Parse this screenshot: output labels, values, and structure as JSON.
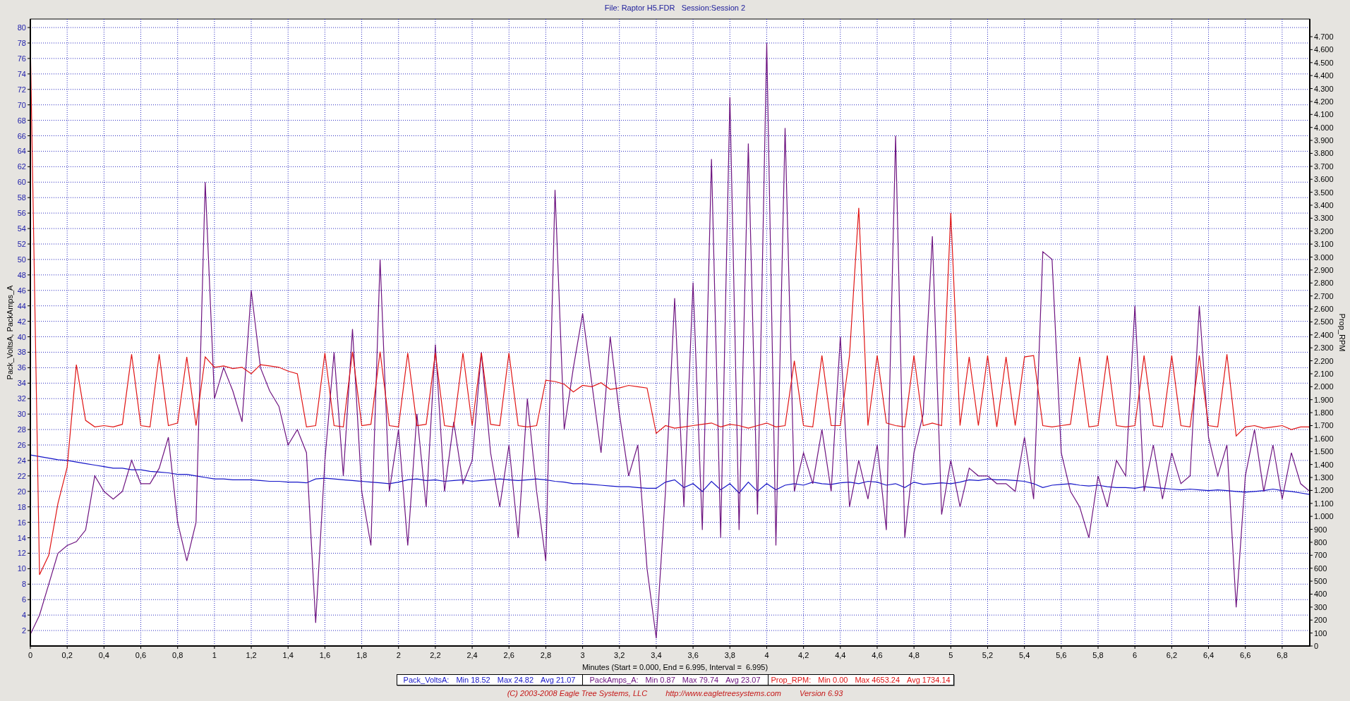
{
  "title": "File: Raptor H5.FDR   Session:Session 2",
  "chart": {
    "chart_data": {
      "type": "line",
      "grid": true,
      "ylabel": "Pack_VoltsA, PackAmps_A",
      "y2label": "Prop_RPM",
      "y2lim": [
        0,
        4836
      ],
      "y2ticks": [
        0,
        100,
        200,
        300,
        400,
        500,
        600,
        700,
        800,
        900,
        {
          "value": 1000,
          "label": "1.000"
        },
        {
          "value": 1100,
          "label": "1.100"
        },
        {
          "value": 1200,
          "label": "1.200"
        },
        {
          "value": 1300,
          "label": "1.300"
        },
        {
          "value": 1400,
          "label": "1.400"
        },
        {
          "value": 1500,
          "label": "1.500"
        },
        {
          "value": 1600,
          "label": "1.600"
        },
        {
          "value": 1700,
          "label": "1.700"
        },
        {
          "value": 1800,
          "label": "1.800"
        },
        {
          "value": 1900,
          "label": "1.900"
        },
        {
          "value": 2000,
          "label": "2.000"
        },
        {
          "value": 2100,
          "label": "2.100"
        },
        {
          "value": 2200,
          "label": "2.200"
        },
        {
          "value": 2300,
          "label": "2.300"
        },
        {
          "value": 2400,
          "label": "2.400"
        },
        {
          "value": 2500,
          "label": "2.500"
        },
        {
          "value": 2600,
          "label": "2.600"
        },
        {
          "value": 2700,
          "label": "2.700"
        },
        {
          "value": 2800,
          "label": "2.800"
        },
        {
          "value": 2900,
          "label": "2.900"
        },
        {
          "value": 3000,
          "label": "3.000"
        },
        {
          "value": 3100,
          "label": "3.100"
        },
        {
          "value": 3200,
          "label": "3.200"
        },
        {
          "value": 3300,
          "label": "3.300"
        },
        {
          "value": 3400,
          "label": "3.400"
        },
        {
          "value": 3500,
          "label": "3.500"
        },
        {
          "value": 3600,
          "label": "3.600"
        },
        {
          "value": 3700,
          "label": "3.700"
        },
        {
          "value": 3800,
          "label": "3.800"
        },
        {
          "value": 3900,
          "label": "3.900"
        },
        {
          "value": 4000,
          "label": "4.000"
        },
        {
          "value": 4100,
          "label": "4.100"
        },
        {
          "value": 4200,
          "label": "4.200"
        },
        {
          "value": 4300,
          "label": "4.300"
        },
        {
          "value": 4400,
          "label": "4.400"
        },
        {
          "value": 4500,
          "label": "4.500"
        },
        {
          "value": 4600,
          "label": "4.600"
        },
        {
          "value": 4700,
          "label": "4.700"
        }
      ],
      "xlim": [
        0,
        6.95
      ],
      "ylim": [
        0,
        81.1
      ],
      "xticks": [
        0,
        {
          "value": 0.2,
          "label": "0,2"
        },
        {
          "value": 0.4,
          "label": "0,4"
        },
        {
          "value": 0.6,
          "label": "0,6"
        },
        {
          "value": 0.8,
          "label": "0,8"
        },
        1,
        {
          "value": 1.2,
          "label": "1,2"
        },
        {
          "value": 1.4,
          "label": "1,4"
        },
        {
          "value": 1.6,
          "label": "1,6"
        },
        {
          "value": 1.8,
          "label": "1,8"
        },
        2,
        {
          "value": 2.2,
          "label": "2,2"
        },
        {
          "value": 2.4,
          "label": "2,4"
        },
        {
          "value": 2.6,
          "label": "2,6"
        },
        {
          "value": 2.8,
          "label": "2,8"
        },
        3,
        {
          "value": 3.2,
          "label": "3,2"
        },
        {
          "value": 3.4,
          "label": "3,4"
        },
        {
          "value": 3.6,
          "label": "3,6"
        },
        {
          "value": 3.8,
          "label": "3,8"
        },
        4,
        {
          "value": 4.2,
          "label": "4,2"
        },
        {
          "value": 4.4,
          "label": "4,4"
        },
        {
          "value": 4.6,
          "label": "4,6"
        },
        {
          "value": 4.8,
          "label": "4,8"
        },
        5,
        {
          "value": 5.2,
          "label": "5,2"
        },
        {
          "value": 5.4,
          "label": "5,4"
        },
        {
          "value": 5.6,
          "label": "5,6"
        },
        {
          "value": 5.8,
          "label": "5,8"
        },
        6,
        {
          "value": 6.2,
          "label": "6,2"
        },
        {
          "value": 6.4,
          "label": "6,4"
        },
        {
          "value": 6.6,
          "label": "6,6"
        },
        {
          "value": 6.8,
          "label": "6,8"
        }
      ],
      "yticks": [
        2,
        4,
        6,
        8,
        10,
        12,
        14,
        16,
        18,
        20,
        22,
        24,
        26,
        28,
        30,
        32,
        34,
        36,
        38,
        40,
        42,
        44,
        46,
        48,
        50,
        52,
        54,
        56,
        58,
        60,
        62,
        64,
        66,
        68,
        70,
        72,
        74,
        76,
        78,
        80
      ],
      "x": [
        0,
        0.05,
        0.1,
        0.15,
        0.2,
        0.25,
        0.3,
        0.35,
        0.4,
        0.45,
        0.5,
        0.55,
        0.6,
        0.65,
        0.7,
        0.75,
        0.8,
        0.85,
        0.9,
        0.95,
        1,
        1.05,
        1.1,
        1.15,
        1.2,
        1.25,
        1.3,
        1.35,
        1.4,
        1.45,
        1.5,
        1.55,
        1.6,
        1.65,
        1.7,
        1.75,
        1.8,
        1.85,
        1.9,
        1.95,
        2,
        2.05,
        2.1,
        2.15,
        2.2,
        2.25,
        2.3,
        2.35,
        2.4,
        2.45,
        2.5,
        2.55,
        2.6,
        2.65,
        2.7,
        2.75,
        2.8,
        2.85,
        2.9,
        2.95,
        3,
        3.05,
        3.1,
        3.15,
        3.2,
        3.25,
        3.3,
        3.35,
        3.4,
        3.45,
        3.5,
        3.55,
        3.6,
        3.65,
        3.7,
        3.75,
        3.8,
        3.85,
        3.9,
        3.95,
        4,
        4.05,
        4.1,
        4.15,
        4.2,
        4.25,
        4.3,
        4.35,
        4.4,
        4.45,
        4.5,
        4.55,
        4.6,
        4.65,
        4.7,
        4.75,
        4.8,
        4.85,
        4.9,
        4.95,
        5,
        5.05,
        5.1,
        5.15,
        5.2,
        5.25,
        5.3,
        5.35,
        5.4,
        5.45,
        5.5,
        5.55,
        5.6,
        5.65,
        5.7,
        5.75,
        5.8,
        5.85,
        5.9,
        5.95,
        6,
        6.05,
        6.1,
        6.15,
        6.2,
        6.25,
        6.3,
        6.35,
        6.4,
        6.45,
        6.5,
        6.55,
        6.6,
        6.65,
        6.7,
        6.75,
        6.8,
        6.85,
        6.9,
        6.95
      ],
      "series": [
        {
          "name": "Pack_VoltsA:",
          "color": "#1414c8",
          "values": [
            24.7,
            24.5,
            24.3,
            24.1,
            24.0,
            23.8,
            23.6,
            23.4,
            23.2,
            23.0,
            23.0,
            22.8,
            22.8,
            22.6,
            22.5,
            22.4,
            22.2,
            22.2,
            22.0,
            21.8,
            21.6,
            21.6,
            21.5,
            21.5,
            21.5,
            21.4,
            21.3,
            21.3,
            21.2,
            21.2,
            21.1,
            21.6,
            21.7,
            21.6,
            21.5,
            21.4,
            21.3,
            21.2,
            21.1,
            21.0,
            21.2,
            21.5,
            21.6,
            21.4,
            21.5,
            21.3,
            21.4,
            21.5,
            21.3,
            21.4,
            21.5,
            21.6,
            21.5,
            21.4,
            21.5,
            21.6,
            21.5,
            21.3,
            21.2,
            21.0,
            21.0,
            20.9,
            20.8,
            20.7,
            20.6,
            20.6,
            20.5,
            20.4,
            20.4,
            21.2,
            21.5,
            20.5,
            21.0,
            20.0,
            21.3,
            20.2,
            21.0,
            19.8,
            21.2,
            20.0,
            21.0,
            20.2,
            20.8,
            21.0,
            20.8,
            21.2,
            21.0,
            20.9,
            21.1,
            21.2,
            21.0,
            21.3,
            21.2,
            20.8,
            21.0,
            20.5,
            21.2,
            20.9,
            21.0,
            21.1,
            21.0,
            21.2,
            21.5,
            21.4,
            21.6,
            21.5,
            21.5,
            21.4,
            21.3,
            21.0,
            20.5,
            20.8,
            20.9,
            21.0,
            20.8,
            20.7,
            20.8,
            20.6,
            20.5,
            20.5,
            20.4,
            20.6,
            20.5,
            20.4,
            20.3,
            20.2,
            20.3,
            20.2,
            20.1,
            20.2,
            20.1,
            20.0,
            19.9,
            20.0,
            20.1,
            20.3,
            20.1,
            20.0,
            19.8,
            19.6
          ]
        },
        {
          "name": "PackAmps_A:",
          "color": "#6e1480",
          "values": [
            1.5,
            4,
            8,
            12,
            13,
            13.5,
            15,
            22,
            20,
            19,
            20,
            24,
            21,
            21,
            23,
            27,
            16,
            11,
            16,
            60,
            32,
            36,
            33,
            29,
            46,
            36,
            33,
            31,
            26,
            28,
            25,
            3,
            24,
            38,
            22,
            41,
            20,
            13,
            50,
            20,
            28,
            13,
            30,
            18,
            39,
            20,
            29,
            21,
            24,
            38,
            25,
            18,
            26,
            14,
            32,
            20,
            11,
            59,
            28,
            36,
            43,
            34,
            25,
            40,
            30,
            22,
            26,
            10,
            1,
            20,
            45,
            18,
            47,
            15,
            63,
            14,
            71,
            15,
            65,
            17,
            78,
            13,
            67,
            20,
            25,
            21,
            28,
            20,
            40,
            18,
            24,
            19,
            26,
            15,
            66,
            14,
            25,
            30,
            53,
            17,
            24,
            18,
            23,
            22,
            22,
            21,
            21,
            20,
            27,
            19,
            51,
            50,
            25,
            20,
            18,
            14,
            22,
            18,
            24,
            22,
            44,
            20,
            26,
            19,
            25,
            21,
            22,
            44,
            27,
            22,
            26,
            5,
            22,
            28,
            20,
            26,
            19,
            25,
            21,
            20
          ]
        },
        {
          "name": "Prop_RPM:",
          "color": "#e01414",
          "axis": "y2",
          "values": [
            4650,
            550,
            700,
            1100,
            1380,
            2170,
            1740,
            1690,
            1700,
            1690,
            1710,
            2250,
            1700,
            1690,
            2250,
            1700,
            1720,
            2230,
            1700,
            2230,
            2150,
            2160,
            2140,
            2150,
            2100,
            2170,
            2160,
            2150,
            2120,
            2100,
            1690,
            1700,
            2260,
            1700,
            1690,
            2270,
            1700,
            1710,
            2270,
            1700,
            1690,
            2260,
            1700,
            1710,
            2260,
            1700,
            1690,
            2260,
            1700,
            2260,
            1710,
            1700,
            2260,
            1700,
            1690,
            1700,
            2050,
            2040,
            2020,
            1960,
            2010,
            2000,
            2030,
            1980,
            1990,
            2010,
            2000,
            1990,
            1640,
            1700,
            1680,
            1690,
            1700,
            1710,
            1720,
            1690,
            1710,
            1700,
            1680,
            1700,
            1720,
            1690,
            1700,
            2200,
            1700,
            1690,
            2240,
            1700,
            1700,
            2240,
            3380,
            1700,
            2240,
            1720,
            1700,
            1690,
            2240,
            1700,
            1720,
            1700,
            3340,
            1700,
            2230,
            1700,
            2240,
            1690,
            2230,
            1700,
            2230,
            2240,
            1700,
            1690,
            1700,
            1710,
            2230,
            1690,
            1700,
            2240,
            1700,
            1690,
            1700,
            2240,
            1700,
            1690,
            2240,
            1700,
            1690,
            2240,
            1700,
            1690,
            2250,
            1620,
            1690,
            1700,
            1680,
            1690,
            1700,
            1670,
            1690,
            1690
          ]
        }
      ]
    },
    "x_caption": "Minutes (Start = 0.000, End = 6.995, Interval =  6.995)"
  },
  "legend": [
    {
      "min": "Min 18.52",
      "max": "Max 24.82",
      "avg": "Avg 21.07"
    },
    {
      "min": "Min 0.87",
      "max": "Max 79.74",
      "avg": "Avg 23.07"
    },
    {
      "min": "Min 0.00",
      "max": "Max 4653.24",
      "avg": "Avg 1734.14"
    }
  ],
  "footer": {
    "copyright": "(C) 2003-2008 Eagle Tree Systems, LLC",
    "url": "http://www.eagletreesystems.com",
    "version": "Version 6.93"
  }
}
